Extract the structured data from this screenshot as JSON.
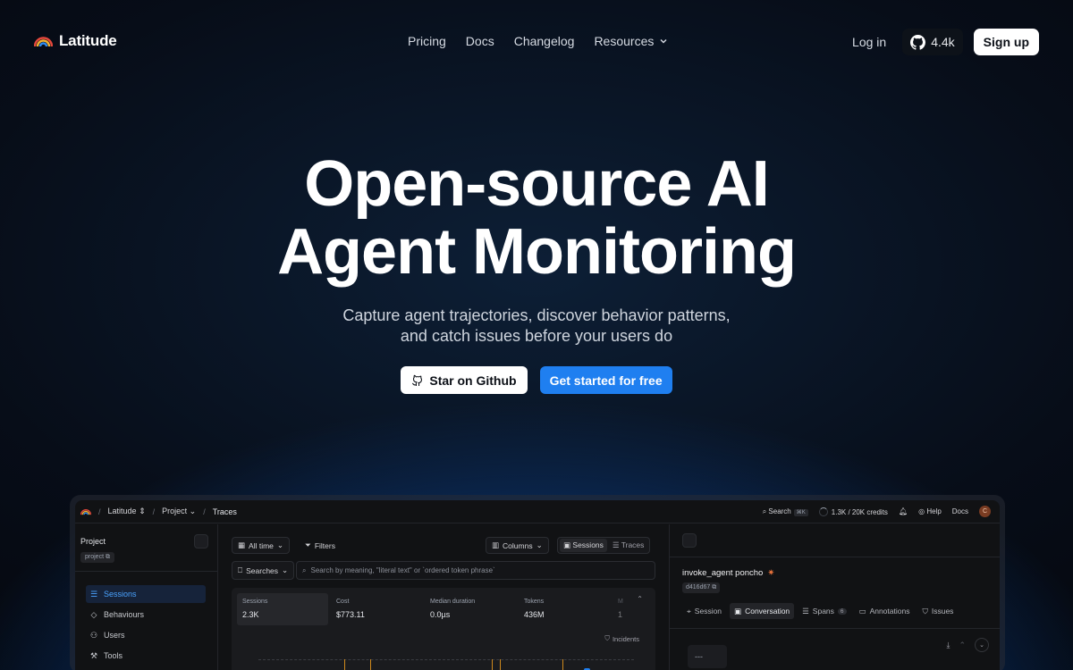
{
  "nav": {
    "brand": "Latitude",
    "links": [
      "Pricing",
      "Docs",
      "Changelog"
    ],
    "resources_label": "Resources",
    "login": "Log in",
    "github_stars": "4.4k",
    "signup": "Sign up"
  },
  "hero": {
    "title_line1": "Open-source AI",
    "title_line2": "Agent Monitoring",
    "subtitle_line1": "Capture agent trajectories, discover behavior patterns,",
    "subtitle_line2": "and catch issues before your users do",
    "cta_github": "Star on Github",
    "cta_start": "Get started for free"
  },
  "app": {
    "breadcrumb": {
      "org": "Latitude",
      "project": "Project",
      "page": "Traces",
      "sep": "/"
    },
    "topbar": {
      "search": "Search",
      "shortcut": "⌘K",
      "credits": "1.3K / 20K credits",
      "help": "Help",
      "docs": "Docs",
      "avatar_initial": "C"
    },
    "sidebar": {
      "project_title": "Project",
      "project_slug": "project",
      "items": [
        {
          "label": "Sessions",
          "icon": "list-icon"
        },
        {
          "label": "Behaviours",
          "icon": "tag-icon"
        },
        {
          "label": "Users",
          "icon": "users-icon"
        },
        {
          "label": "Tools",
          "icon": "wrench-icon"
        }
      ]
    },
    "toolbar": {
      "time_range": "All time",
      "filters": "Filters",
      "columns": "Columns",
      "view_sessions": "Sessions",
      "view_traces": "Traces",
      "searches": "Searches",
      "search_placeholder": "Search by meaning, \"literal text\" or `ordered token phrase`"
    },
    "stats": [
      {
        "label": "Sessions",
        "value": "2.3K"
      },
      {
        "label": "Cost",
        "value": "$773.11"
      },
      {
        "label": "Median duration",
        "value": "0.0µs"
      },
      {
        "label": "Tokens",
        "value": "436M"
      },
      {
        "label": "M",
        "value": "1"
      }
    ],
    "incidents_label": "Incidents",
    "panel": {
      "run_title": "invoke_agent poncho",
      "run_id": "d416d67",
      "tabs": [
        {
          "label": "Session"
        },
        {
          "label": "Conversation"
        },
        {
          "label": "Spans",
          "badge": "6"
        },
        {
          "label": "Annotations"
        },
        {
          "label": "Issues"
        }
      ],
      "message_placeholder": "---"
    }
  },
  "colors": {
    "accent": "#1f7ff0",
    "active_item": "#4aa3ff",
    "incident_marker": "#d08a1c"
  }
}
